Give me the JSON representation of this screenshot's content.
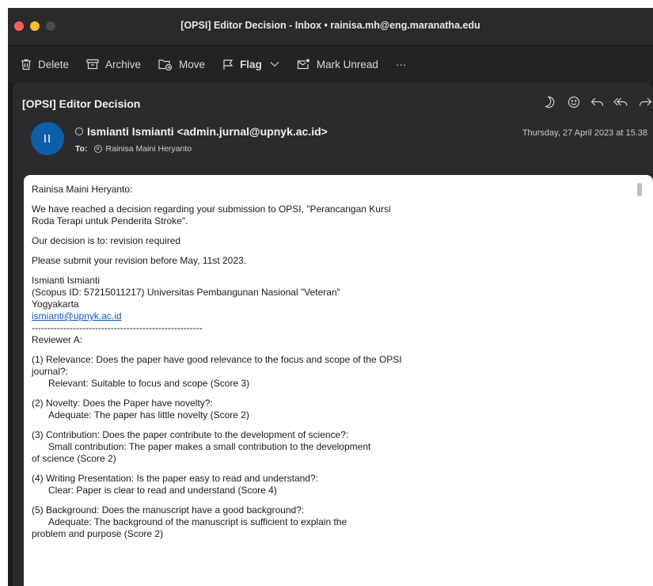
{
  "window": {
    "title": "[OPSI] Editor Decision - Inbox • rainisa.mh@eng.maranatha.edu"
  },
  "colors": {
    "close": "#ff5f57",
    "minimize": "#febc2e",
    "zoom": "#4a4a4c",
    "avatar": "#0f5ea8",
    "link": "#1155cc"
  },
  "toolbar": {
    "delete": "Delete",
    "archive": "Archive",
    "move": "Move",
    "flag": "Flag",
    "mark_unread": "Mark Unread",
    "more": "···"
  },
  "message": {
    "subject": "[OPSI] Editor Decision",
    "avatar_initials": "II",
    "from": "Ismianti Ismianti <admin.jurnal@upnyk.ac.id>",
    "to_label": "To:",
    "to": "Rainisa Maini Heryanto",
    "date": "Thursday, 27 April 2023 at 15.38",
    "icons": [
      "moon-icon",
      "smiley-icon",
      "reply-icon",
      "reply-all-icon",
      "forward-icon"
    ]
  },
  "body": {
    "greeting": "Rainisa Maini Heryanto:",
    "p1": "We have reached a decision regarding your submission to OPSI, \"Perancangan Kursi Roda Terapi untuk Penderita Stroke\".",
    "p2": "Our decision is to: revision required",
    "p3": "Please submit your revision before May, 11st 2023.",
    "sig_name": "Ismianti Ismianti",
    "sig_line2": "(Scopus ID: 57215011217) Universitas Pembangunan Nasional \"Veteran\"",
    "sig_line3": "Yogyakarta",
    "sig_email": "ismianti@upnyk.ac.id",
    "separator": "------------------------------------------------------",
    "reviewer": "Reviewer A:",
    "criteria": [
      {
        "q": "(1) Relevance: Does the paper have good relevance to the focus and scope of the OPSI journal?:",
        "a": "Relevant: Suitable to focus and scope (Score 3)"
      },
      {
        "q": "(2) Novelty: Does the Paper have novelty?:",
        "a": "Adequate: The paper has little novelty (Score 2)"
      },
      {
        "q": "(3) Contribution: Does the paper contribute to the development of science?:",
        "a": "Small contribution: The paper makes a small contribution to the development",
        "a2": "of science (Score 2)"
      },
      {
        "q": "(4) Writing Presentation: Is the paper easy to read and understand?:",
        "a": "Clear: Paper is clear to read and understand (Score 4)"
      },
      {
        "q": "(5) Background: Does the manuscript have a good background?:",
        "a": "Adequate: The background of the manuscript is sufficient to explain the",
        "a2": "problem and purpose (Score 2)"
      }
    ]
  }
}
